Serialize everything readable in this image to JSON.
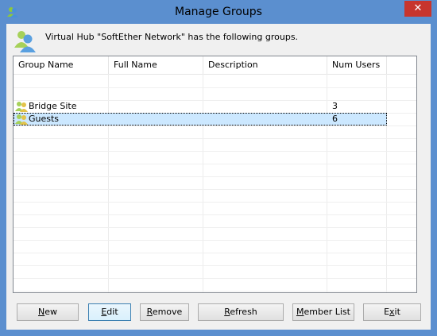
{
  "window": {
    "title": "Manage Groups",
    "close_glyph": "✕"
  },
  "header": {
    "icon": "group-users-icon",
    "message": "Virtual Hub \"SoftEther Network\" has the following groups."
  },
  "table": {
    "columns": [
      "Group Name",
      "Full Name",
      "Description",
      "Num Users"
    ],
    "rows": [
      {
        "group_name": "Bridge Site",
        "full_name": "",
        "description": "",
        "num_users": "3"
      },
      {
        "group_name": "Guests",
        "full_name": "",
        "description": "",
        "num_users": "6",
        "selected": true
      }
    ]
  },
  "buttons": {
    "new": {
      "accel": "N",
      "rest": "ew"
    },
    "edit": {
      "accel": "E",
      "rest": "dit"
    },
    "remove": {
      "accel": "R",
      "rest": "emove"
    },
    "refresh": {
      "accel": "R",
      "rest": "efresh"
    },
    "member_list": {
      "accel": "M",
      "rest": "ember List"
    },
    "exit": {
      "pre": "E",
      "accel": "x",
      "rest": "it"
    }
  },
  "colors": {
    "frame": "#5b8fcf",
    "close": "#c7352d",
    "selection": "#cce8ff"
  }
}
